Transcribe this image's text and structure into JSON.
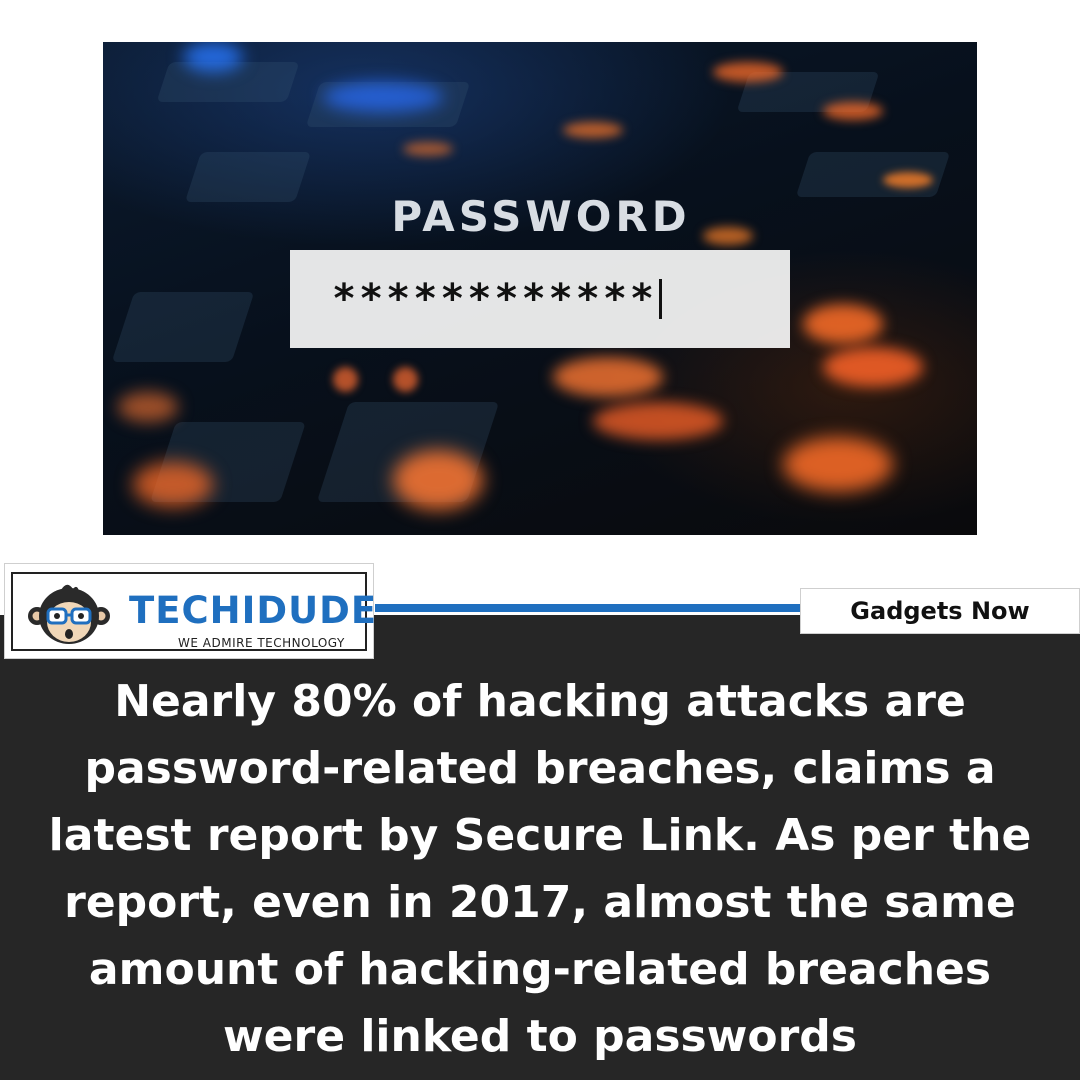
{
  "hero": {
    "title": "PASSWORD",
    "masked_value": "************",
    "icon": "keyboard-photo"
  },
  "brand": {
    "name": "TECHIDUDE",
    "tagline": "WE ADMIRE TECHNOLOGY",
    "icon": "monkey-mascot-icon",
    "accent_color": "#1f6fbf"
  },
  "source": {
    "label": "Gadgets Now"
  },
  "headline": {
    "text": "Nearly 80% of hacking attacks are password-related breaches, claims a latest report by Secure Link. As per the report, even in 2017, almost the same amount of hacking-related breaches were linked to passwords"
  },
  "colors": {
    "panel_background": "#262626",
    "headline_text": "#ffffff"
  }
}
